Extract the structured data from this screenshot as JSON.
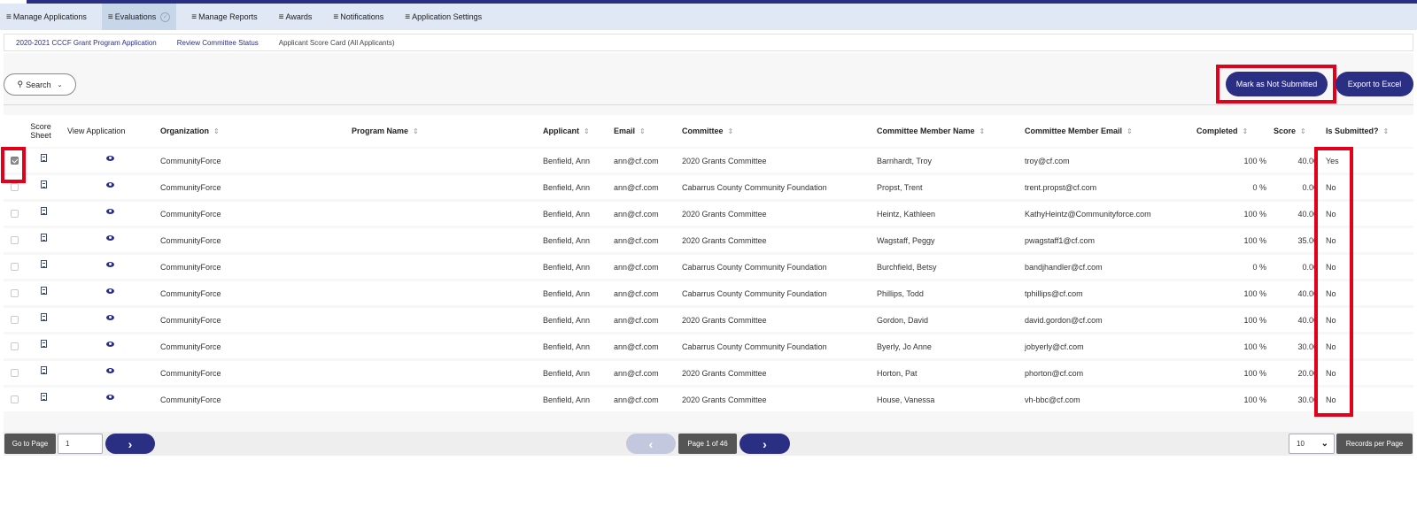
{
  "nav": {
    "items": [
      {
        "label": "Manage Applications"
      },
      {
        "label": "Evaluations"
      },
      {
        "label": "Manage Reports"
      },
      {
        "label": "Awards"
      },
      {
        "label": "Notifications"
      },
      {
        "label": "Application Settings"
      }
    ],
    "active_index": 1
  },
  "breadcrumb": {
    "items": [
      "2020-2021 CCCF Grant Program Application",
      "Review Committee Status",
      "Applicant Score Card (All Applicants)"
    ]
  },
  "toolbar": {
    "search_label": "Search",
    "mark_not_submitted_label": "Mark as Not Submitted",
    "export_label": "Export to Excel"
  },
  "table": {
    "headers": {
      "score_sheet_line1": "Score",
      "score_sheet_line2": "Sheet",
      "view_application": "View Application",
      "organization": "Organization",
      "program_name": "Program Name",
      "applicant": "Applicant",
      "email": "Email",
      "committee": "Committee",
      "member_name": "Committee Member Name",
      "member_email": "Committee Member Email",
      "completed": "Completed",
      "score": "Score",
      "submitted": "Is Submitted?"
    },
    "rows": [
      {
        "checked": true,
        "organization": "CommunityForce",
        "program": "",
        "applicant": "Benfield, Ann",
        "email": "ann@cf.com",
        "committee": "2020 Grants Committee",
        "member_name": "Barnhardt, Troy",
        "member_email": "troy@cf.com",
        "completed": "100 %",
        "score": "40.00",
        "submitted": "Yes"
      },
      {
        "checked": false,
        "organization": "CommunityForce",
        "program": "",
        "applicant": "Benfield, Ann",
        "email": "ann@cf.com",
        "committee": "Cabarrus County Community Foundation",
        "member_name": "Propst, Trent",
        "member_email": "trent.propst@cf.com",
        "completed": "0 %",
        "score": "0.00",
        "submitted": "No"
      },
      {
        "checked": false,
        "organization": "CommunityForce",
        "program": "",
        "applicant": "Benfield, Ann",
        "email": "ann@cf.com",
        "committee": "2020 Grants Committee",
        "member_name": "Heintz, Kathleen",
        "member_email": "KathyHeintz@Communityforce.com",
        "completed": "100 %",
        "score": "40.00",
        "submitted": "No"
      },
      {
        "checked": false,
        "organization": "CommunityForce",
        "program": "",
        "applicant": "Benfield, Ann",
        "email": "ann@cf.com",
        "committee": "2020 Grants Committee",
        "member_name": "Wagstaff, Peggy",
        "member_email": "pwagstaff1@cf.com",
        "completed": "100 %",
        "score": "35.00",
        "submitted": "No"
      },
      {
        "checked": false,
        "organization": "CommunityForce",
        "program": "",
        "applicant": "Benfield, Ann",
        "email": "ann@cf.com",
        "committee": "Cabarrus County Community Foundation",
        "member_name": "Burchfield, Betsy",
        "member_email": "bandjhandler@cf.com",
        "completed": "0 %",
        "score": "0.00",
        "submitted": "No"
      },
      {
        "checked": false,
        "organization": "CommunityForce",
        "program": "",
        "applicant": "Benfield, Ann",
        "email": "ann@cf.com",
        "committee": "Cabarrus County Community Foundation",
        "member_name": "Phillips, Todd",
        "member_email": "tphillips@cf.com",
        "completed": "100 %",
        "score": "40.00",
        "submitted": "No"
      },
      {
        "checked": false,
        "organization": "CommunityForce",
        "program": "",
        "applicant": "Benfield, Ann",
        "email": "ann@cf.com",
        "committee": "2020 Grants Committee",
        "member_name": "Gordon, David",
        "member_email": "david.gordon@cf.com",
        "completed": "100 %",
        "score": "40.00",
        "submitted": "No"
      },
      {
        "checked": false,
        "organization": "CommunityForce",
        "program": "",
        "applicant": "Benfield, Ann",
        "email": "ann@cf.com",
        "committee": "Cabarrus County Community Foundation",
        "member_name": "Byerly, Jo Anne",
        "member_email": "jobyerly@cf.com",
        "completed": "100 %",
        "score": "30.00",
        "submitted": "No"
      },
      {
        "checked": false,
        "organization": "CommunityForce",
        "program": "",
        "applicant": "Benfield, Ann",
        "email": "ann@cf.com",
        "committee": "2020 Grants Committee",
        "member_name": "Horton, Pat",
        "member_email": "phorton@cf.com",
        "completed": "100 %",
        "score": "20.00",
        "submitted": "No"
      },
      {
        "checked": false,
        "organization": "CommunityForce",
        "program": "",
        "applicant": "Benfield, Ann",
        "email": "ann@cf.com",
        "committee": "2020 Grants Committee",
        "member_name": "House, Vanessa",
        "member_email": "vh-bbc@cf.com",
        "completed": "100 %",
        "score": "30.00",
        "submitted": "No"
      }
    ]
  },
  "pagination": {
    "go_to_page_label": "Go to Page",
    "page_value": "1",
    "page_status": "Page 1 of 46",
    "per_page_value": "10",
    "records_per_page_label": "Records per Page"
  },
  "colors": {
    "primary": "#2b2f83",
    "highlight": "#e3001b",
    "nav_bg": "#dfe8f4"
  }
}
